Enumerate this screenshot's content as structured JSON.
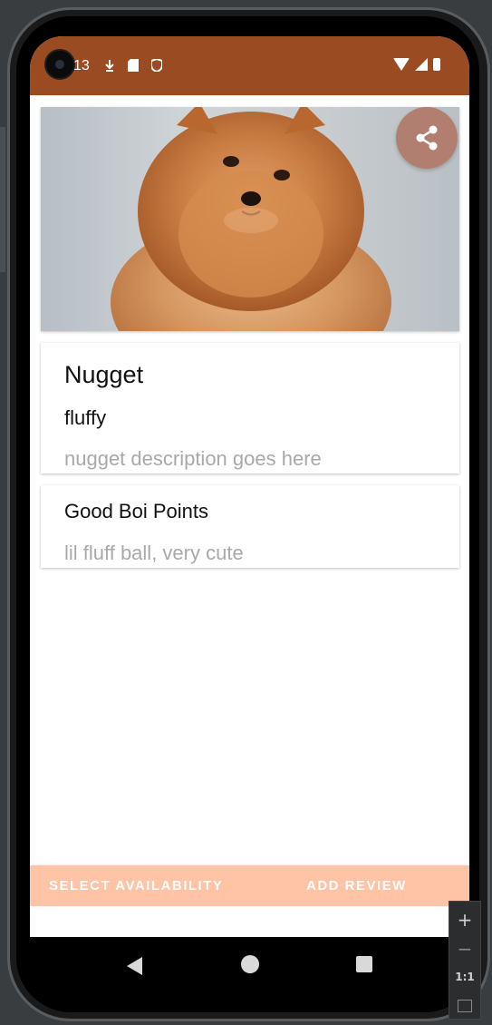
{
  "status_bar": {
    "time": "13",
    "background_color": "#9b4b22",
    "icons": [
      "camera-cutout-icon",
      "download-icon",
      "sd-card-icon",
      "shield-icon",
      "wifi-icon",
      "signal-icon",
      "battery-icon"
    ]
  },
  "hero": {
    "image": "pomeranian-puppy",
    "share_icon": "share-icon"
  },
  "details_card": {
    "name": "Nugget",
    "subtitle": "fluffy",
    "description": "nugget description goes here"
  },
  "points_card": {
    "title": "Good Boi Points",
    "text": "lil fluff ball, very cute"
  },
  "bottom_actions": {
    "select_availability": "SELECT AVAILABILITY",
    "add_review": "ADD REVIEW",
    "bar_color": "#ffc3a6"
  },
  "navigation": {
    "back_icon": "back-icon",
    "home_icon": "home-icon",
    "recents_icon": "recents-icon"
  },
  "emulator_zoom": {
    "zoom_in": "+",
    "zoom_out": "−",
    "actual_size": "1:1"
  }
}
